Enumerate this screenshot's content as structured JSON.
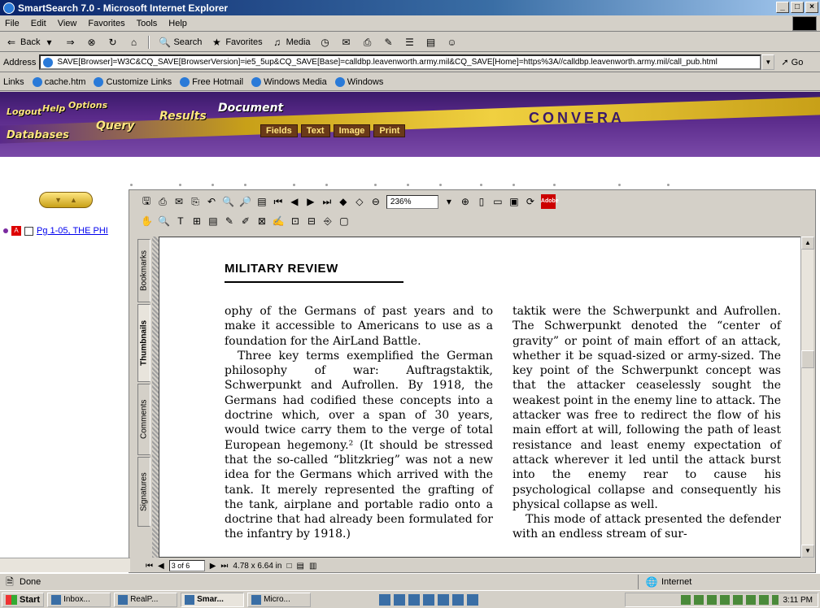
{
  "window": {
    "title": "SmartSearch 7.0 - Microsoft Internet Explorer",
    "min": "_",
    "max": "□",
    "close": "×"
  },
  "menu": [
    "File",
    "Edit",
    "View",
    "Favorites",
    "Tools",
    "Help"
  ],
  "toolbar": {
    "back": "Back",
    "search": "Search",
    "favorites": "Favorites",
    "media": "Media"
  },
  "address": {
    "label": "Address",
    "url": "SAVE[Browser]=W3C&CQ_SAVE[BrowserVersion]=ie5_5up&CQ_SAVE[Base]=calldbp.leavenworth.army.mil&CQ_SAVE[Home]=https%3A//calldbp.leavenworth.army.mil/call_pub.html",
    "go": "Go"
  },
  "links": {
    "label": "Links",
    "items": [
      "cache.htm",
      "Customize Links",
      "Free Hotmail",
      "Windows Media",
      "Windows"
    ]
  },
  "banner": {
    "logout": "Logout",
    "help": "Help",
    "options": "Options",
    "databases": "Databases",
    "query": "Query",
    "results": "Results",
    "document": "Document",
    "brand": "CONVERA",
    "subtabs": [
      "Fields",
      "Text",
      "Image",
      "Print"
    ]
  },
  "doc_list": {
    "item_label": "Pg 1-05, THE PHI"
  },
  "viewer": {
    "zoom": "236%",
    "page_indicator": "3 of 6",
    "page_size": "4.78 x 6.64 in",
    "adobe": "Adobe",
    "tabs": [
      "Bookmarks",
      "Thumbnails",
      "Comments",
      "Signatures"
    ]
  },
  "page": {
    "title": "MILITARY REVIEW",
    "left_col": [
      "ophy of the Germans of past years and to make it accessible to Americans to use as a foundation for the AirLand Battle.",
      "Three key terms exemplified the German philosophy of war: Auftragstaktik, Schwerpunkt and Aufrollen. By 1918, the Germans had codified these concepts into a doctrine which, over a span of 30 years, would twice carry them to the verge of total European hegemony.² (It should be stressed that the so-called “blitzkrieg” was not a new idea for the Germans which arrived with the tank. It merely represented the grafting of the tank, airplane and portable radio onto a doctrine that had already been formulated for the infantry by 1918.)"
    ],
    "right_col": [
      "taktik were the Schwerpunkt and Aufrollen. The Schwerpunkt denoted the “center of gravity” or point of main effort of an attack, whether it be squad-sized or army-sized. The key point of the Schwerpunkt concept was that the attacker ceaselessly sought the weakest point in the enemy line to attack. The attacker was free to redirect the flow of his main effort at will, following the path of least resistance and least enemy expectation of attack wherever it led until the attack burst into the enemy rear to cause his psychological collapse and consequently his physical collapse as well.",
      "This mode of attack presented the defender with an endless stream of sur-"
    ]
  },
  "status": {
    "text": "Done",
    "zone": "Internet"
  },
  "taskbar": {
    "start": "Start",
    "tasks": [
      "Inbox...",
      "RealP...",
      "Smar...",
      "Micro..."
    ],
    "clock": "3:11 PM"
  }
}
